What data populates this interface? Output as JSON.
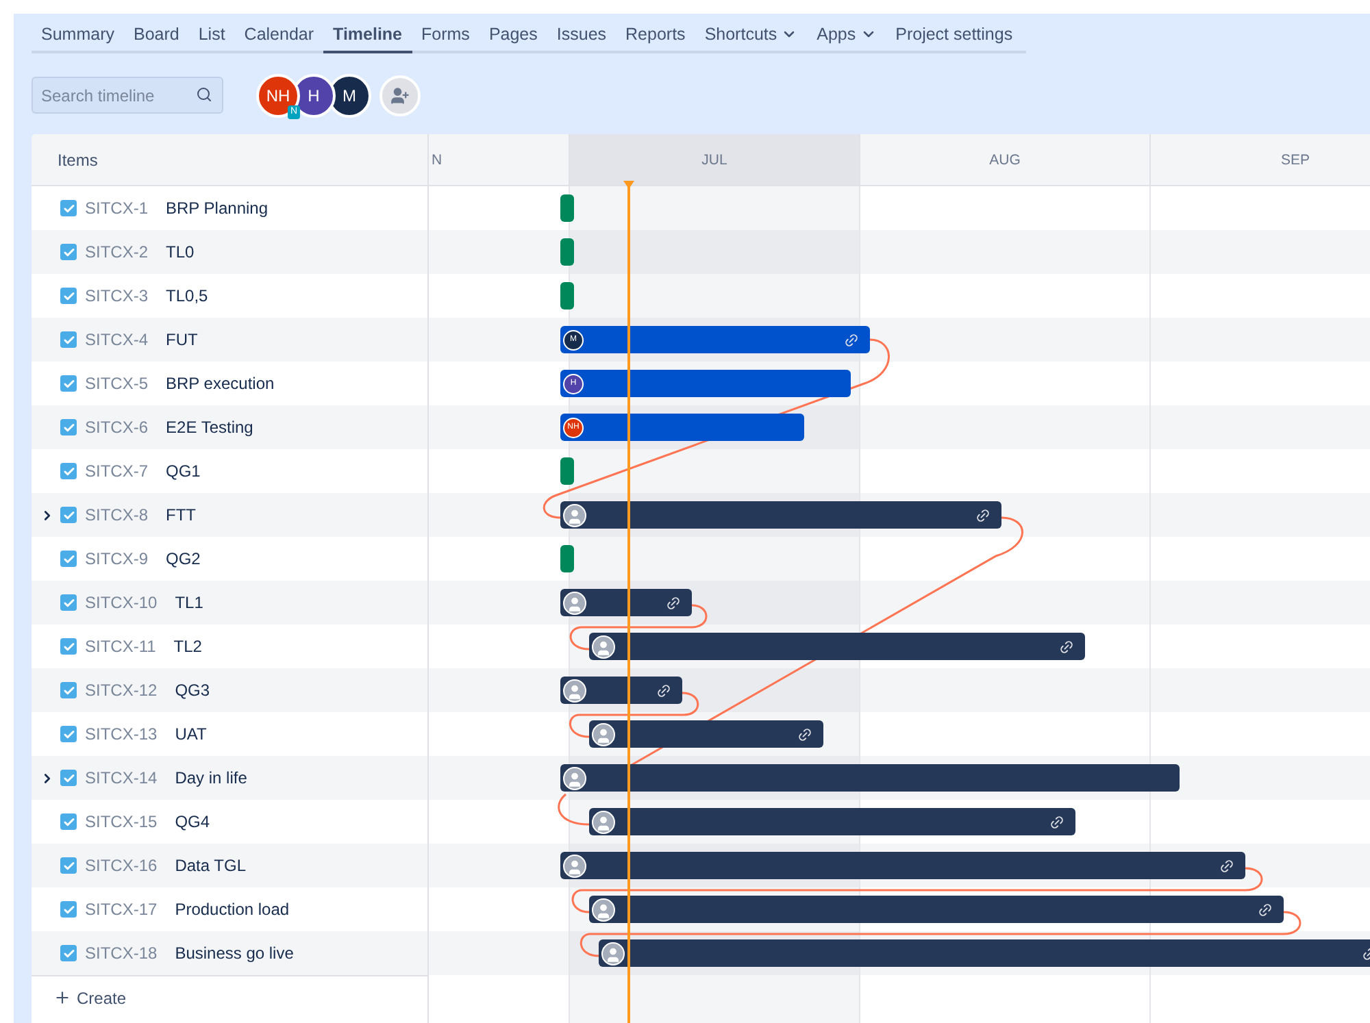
{
  "nav": {
    "tabs": [
      {
        "label": "Summary",
        "selected": false,
        "dropdown": false
      },
      {
        "label": "Board",
        "selected": false,
        "dropdown": false
      },
      {
        "label": "List",
        "selected": false,
        "dropdown": false
      },
      {
        "label": "Calendar",
        "selected": false,
        "dropdown": false
      },
      {
        "label": "Timeline",
        "selected": true,
        "dropdown": false
      },
      {
        "label": "Forms",
        "selected": false,
        "dropdown": false
      },
      {
        "label": "Pages",
        "selected": false,
        "dropdown": false
      },
      {
        "label": "Issues",
        "selected": false,
        "dropdown": false
      },
      {
        "label": "Reports",
        "selected": false,
        "dropdown": false
      },
      {
        "label": "Shortcuts",
        "selected": false,
        "dropdown": true
      },
      {
        "label": "Apps",
        "selected": false,
        "dropdown": true
      },
      {
        "label": "Project settings",
        "selected": false,
        "dropdown": false
      }
    ]
  },
  "toolbar": {
    "search": {
      "placeholder": "Search timeline"
    },
    "avatars": [
      {
        "initials": "NH",
        "color": "#de350b",
        "badge": "N"
      },
      {
        "initials": "H",
        "color": "#5243aa"
      },
      {
        "initials": "M",
        "color": "#172b4d"
      }
    ]
  },
  "timeline": {
    "items_header": "Items",
    "months": [
      {
        "label": "N",
        "current": false
      },
      {
        "label": "JUL",
        "current": true
      },
      {
        "label": "AUG",
        "current": false
      },
      {
        "label": "SEP",
        "current": false
      }
    ],
    "rows": [
      {
        "key": "SITCX-1",
        "summary": "BRP Planning",
        "has_children": false,
        "bar": {
          "kind": "milestone",
          "linked": false
        }
      },
      {
        "key": "SITCX-2",
        "summary": "TL0",
        "has_children": false,
        "bar": {
          "kind": "milestone",
          "linked": false
        }
      },
      {
        "key": "SITCX-3",
        "summary": "TL0,5",
        "has_children": false,
        "bar": {
          "kind": "milestone",
          "linked": false
        }
      },
      {
        "key": "SITCX-4",
        "summary": "FUT",
        "has_children": false,
        "bar": {
          "kind": "epic",
          "linked": true,
          "assignee": {
            "initials": "M",
            "color": "#172b4d"
          }
        }
      },
      {
        "key": "SITCX-5",
        "summary": "BRP execution",
        "has_children": false,
        "bar": {
          "kind": "epic",
          "linked": false,
          "assignee": {
            "initials": "H",
            "color": "#5243aa"
          }
        }
      },
      {
        "key": "SITCX-6",
        "summary": "E2E Testing",
        "has_children": false,
        "bar": {
          "kind": "epic",
          "linked": false,
          "assignee": {
            "initials": "NH",
            "color": "#de350b"
          }
        }
      },
      {
        "key": "SITCX-7",
        "summary": "QG1",
        "has_children": false,
        "bar": {
          "kind": "milestone",
          "linked": false
        }
      },
      {
        "key": "SITCX-8",
        "summary": "FTT",
        "has_children": true,
        "bar": {
          "kind": "task",
          "linked": true
        }
      },
      {
        "key": "SITCX-9",
        "summary": "QG2",
        "has_children": false,
        "bar": {
          "kind": "milestone",
          "linked": false
        }
      },
      {
        "key": "SITCX-10",
        "summary": "TL1",
        "has_children": false,
        "bar": {
          "kind": "task",
          "linked": true
        }
      },
      {
        "key": "SITCX-11",
        "summary": "TL2",
        "has_children": false,
        "bar": {
          "kind": "task",
          "linked": true
        }
      },
      {
        "key": "SITCX-12",
        "summary": "QG3",
        "has_children": false,
        "bar": {
          "kind": "task",
          "linked": true
        }
      },
      {
        "key": "SITCX-13",
        "summary": "UAT",
        "has_children": false,
        "bar": {
          "kind": "task",
          "linked": true
        }
      },
      {
        "key": "SITCX-14",
        "summary": "Day in life",
        "has_children": true,
        "bar": {
          "kind": "task",
          "linked": false
        }
      },
      {
        "key": "SITCX-15",
        "summary": "QG4",
        "has_children": false,
        "bar": {
          "kind": "task",
          "linked": true
        }
      },
      {
        "key": "SITCX-16",
        "summary": "Data TGL",
        "has_children": false,
        "bar": {
          "kind": "task",
          "linked": true
        }
      },
      {
        "key": "SITCX-17",
        "summary": "Production load",
        "has_children": false,
        "bar": {
          "kind": "task",
          "linked": true
        }
      },
      {
        "key": "SITCX-18",
        "summary": "Business go live",
        "has_children": false,
        "bar": {
          "kind": "task",
          "linked": true
        }
      }
    ],
    "create": "Create"
  }
}
